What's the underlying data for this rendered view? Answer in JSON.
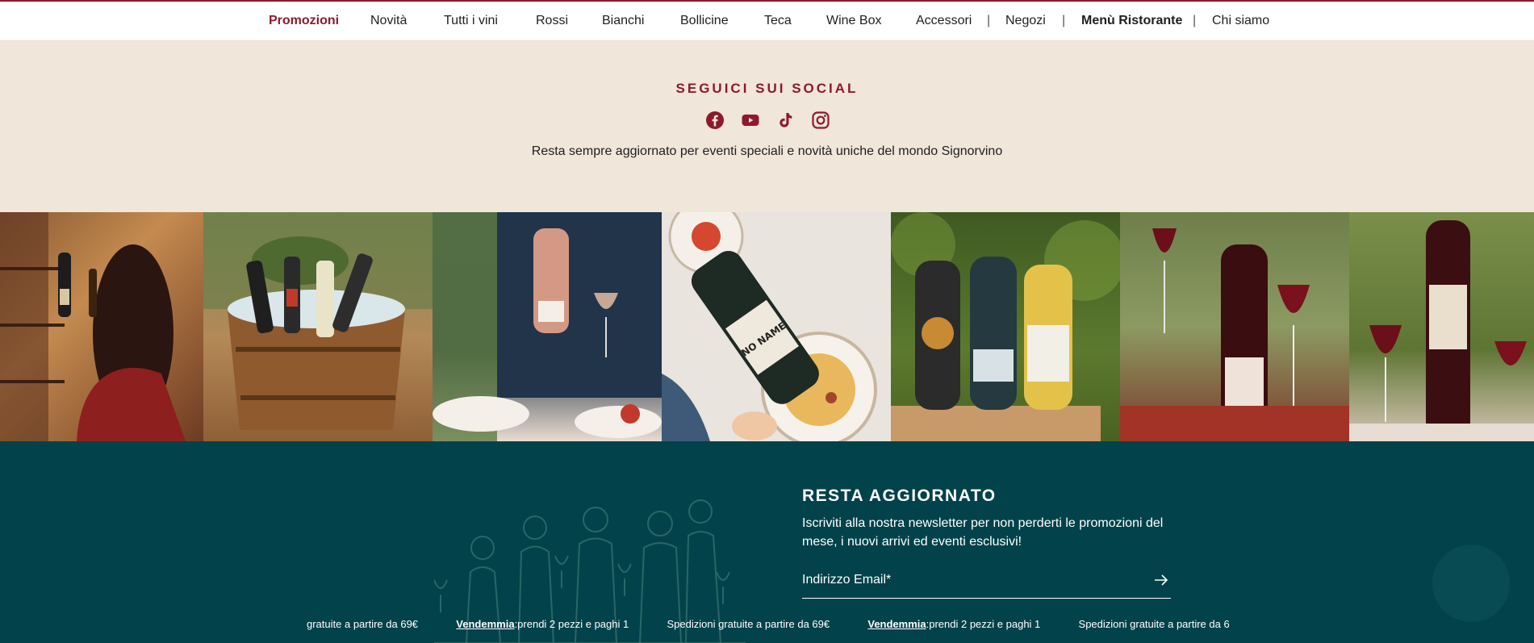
{
  "nav": {
    "items": [
      {
        "label": "Promozioni"
      },
      {
        "label": "Novità"
      },
      {
        "label": "Tutti i vini"
      },
      {
        "label": "Rossi"
      },
      {
        "label": "Bianchi"
      },
      {
        "label": "Bollicine"
      },
      {
        "label": "Teca"
      },
      {
        "label": "Wine Box"
      },
      {
        "label": "Accessori"
      },
      {
        "label": "Negozi"
      },
      {
        "label": "Menù Ristorante"
      },
      {
        "label": "Chi siamo"
      }
    ],
    "separator": "|",
    "active_color": "#8c1a2f"
  },
  "social": {
    "title": "SEGUICI SUI SOCIAL",
    "subtitle": "Resta sempre aggiornato per eventi speciali e novità uniche del mondo Signorvino",
    "icons": [
      "facebook-icon",
      "youtube-icon",
      "tiktok-icon",
      "instagram-icon"
    ]
  },
  "photos": {
    "bottle_label": "NO NAME"
  },
  "newsletter": {
    "title": "RESTA AGGIORNATO",
    "text": "Iscriviti alla nostra newsletter per non perderti le promozioni del mese, i nuovi arrivi ed eventi esclusivi!",
    "email_label": "Indirizzo Email*",
    "submit_icon": "arrow-right-icon"
  },
  "ticker": {
    "items": [
      {
        "bold": "",
        "text": "gratuite a partire da 69€"
      },
      {
        "bold": "Vendemmia",
        "text": ":prendi 2 pezzi e paghi 1"
      },
      {
        "bold": "",
        "text": "Spedizioni gratuite a partire da 69€"
      },
      {
        "bold": "Vendemmia",
        "text": ":prendi 2 pezzi e paghi 1"
      },
      {
        "bold": "",
        "text": "Spedizioni gratuite a partire da 6"
      }
    ]
  },
  "colors": {
    "brand": "#8c1a2f",
    "cream": "#f0e6d9",
    "teal": "#02424a"
  }
}
